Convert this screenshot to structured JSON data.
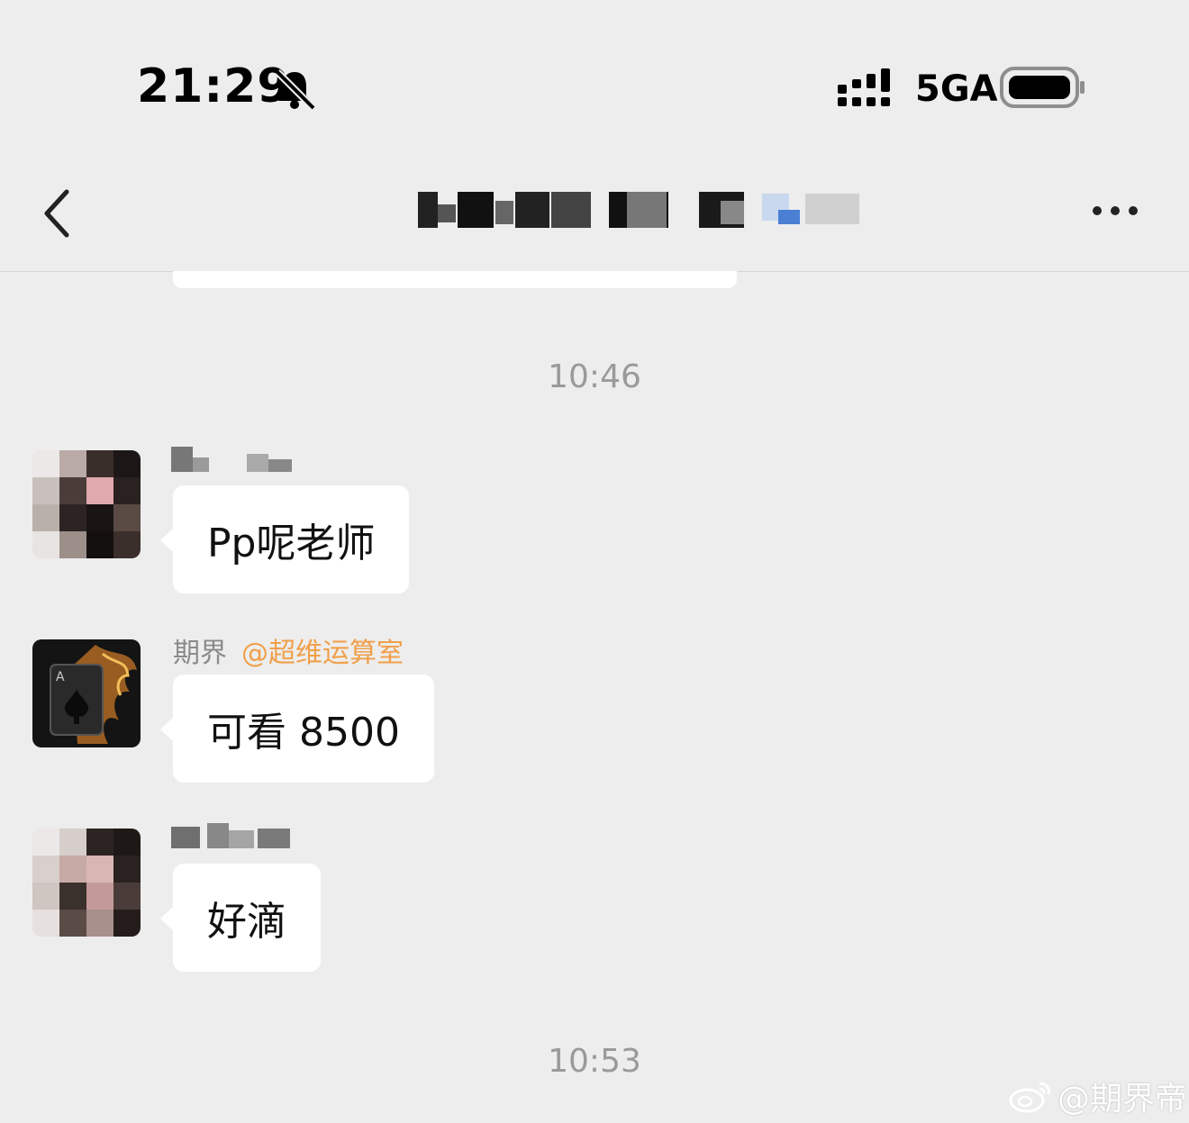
{
  "status_bar": {
    "time": "21:29",
    "network": "5GA",
    "icons": [
      "bell-slash-icon",
      "signal-icon",
      "battery-icon"
    ]
  },
  "header": {
    "back_icon": "chevron-left-icon",
    "more_icon": "more-dots-icon"
  },
  "messages": [
    {
      "type": "timestamp",
      "text": "10:46"
    },
    {
      "type": "message",
      "sender": "",
      "text": "Pp呢老师"
    },
    {
      "type": "message",
      "sender": "期界",
      "tag": "@超维运算室",
      "text": "可看 8500"
    },
    {
      "type": "message",
      "sender": "",
      "text": "好滴"
    },
    {
      "type": "timestamp",
      "text": "10:53"
    }
  ],
  "watermark": {
    "text": "@期界帝"
  },
  "colors": {
    "background": "#ededed",
    "bubble": "#ffffff",
    "tag": "#f0a04b",
    "timestamp": "#9a9a9a"
  }
}
